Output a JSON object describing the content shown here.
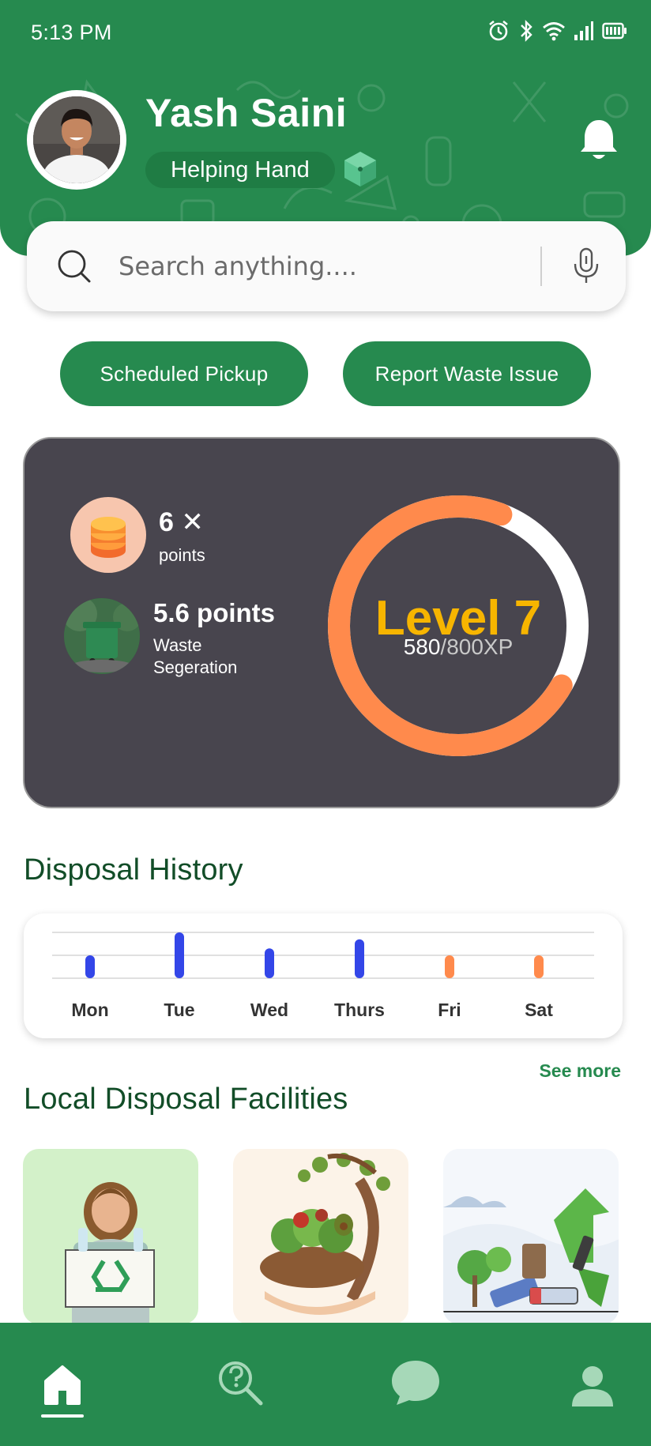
{
  "status_bar": {
    "time": "5:13 PM",
    "icons": [
      "alarm-icon",
      "bluetooth-icon",
      "wifi-icon",
      "signal-icon",
      "battery-icon"
    ]
  },
  "header": {
    "user_name": "Yash Saini",
    "badge_label": "Helping Hand",
    "icons": [
      "avatar",
      "gem-icon",
      "bell-icon"
    ]
  },
  "search": {
    "placeholder": "Search anything...."
  },
  "actions": {
    "scheduled_pickup": "Scheduled Pickup",
    "report_waste_issue": "Report Waste Issue"
  },
  "points_card": {
    "multiplier": "6 ✕",
    "multiplier_label": "points",
    "segregation_points": "5.6 points",
    "segregation_label": "Waste Segeration",
    "level": "Level 7",
    "xp_current": "580",
    "xp_total": "/800XP",
    "xp_progress": 0.725
  },
  "disposal_history": {
    "title": "Disposal History"
  },
  "chart_data": {
    "type": "bar",
    "categories": [
      "Mon",
      "Tue",
      "Wed",
      "Thurs",
      "Fri",
      "Sat"
    ],
    "values": [
      1,
      2,
      1.3,
      1.7,
      1,
      1
    ],
    "bar_colors": [
      "#3346e8",
      "#3346e8",
      "#3346e8",
      "#3346e8",
      "#ff8a4c",
      "#ff8a4c"
    ],
    "ylim": [
      0,
      2
    ],
    "grid": true,
    "title": "",
    "xlabel": "",
    "ylabel": ""
  },
  "facilities": {
    "title": "Local Disposal Facilities",
    "see_more": "See more",
    "cards": [
      {
        "icon": "recycling-person-illustration"
      },
      {
        "icon": "organic-waste-illustration"
      },
      {
        "icon": "battery-recycling-illustration"
      }
    ]
  },
  "bottom_nav": {
    "items": [
      "home-icon",
      "search-help-icon",
      "chat-icon",
      "profile-icon"
    ],
    "active": "home-icon"
  },
  "colors": {
    "primary_green": "#268a4f",
    "dark_card": "#48454e",
    "level_yellow": "#f7b500",
    "ring_orange": "#ff8a4c",
    "bar_blue": "#3346e8"
  }
}
